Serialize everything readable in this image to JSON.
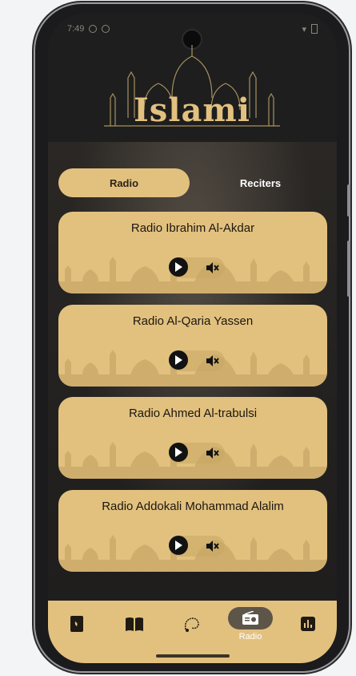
{
  "status": {
    "time": "7:49"
  },
  "brand": {
    "logo_text": "Islami"
  },
  "tabs": [
    {
      "label": "Radio",
      "active": true
    },
    {
      "label": "Reciters",
      "active": false
    }
  ],
  "stations": [
    {
      "name": "Radio Ibrahim Al-Akdar"
    },
    {
      "name": "Radio Al-Qaria Yassen"
    },
    {
      "name": "Radio Ahmed Al-trabulsi"
    },
    {
      "name": "Radio Addokali Mohammad Alalim"
    }
  ],
  "navbar": {
    "items": [
      {
        "icon": "quran-icon"
      },
      {
        "icon": "hadith-book-icon"
      },
      {
        "icon": "sebha-icon"
      },
      {
        "icon": "radio-icon",
        "label": "Radio",
        "active": true
      },
      {
        "icon": "time-icon"
      }
    ]
  },
  "colors": {
    "accent": "#E2C17F",
    "dark": "#202020",
    "pill": "#5E5549"
  }
}
